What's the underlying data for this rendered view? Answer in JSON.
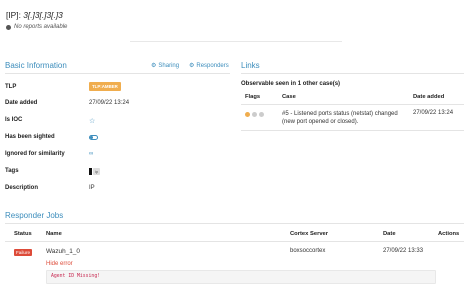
{
  "header": {
    "prefix": "[IP]:",
    "value": "3[.]3[.]3[.]3",
    "no_reports": "No reports available"
  },
  "basic": {
    "title": "Basic Information",
    "sharing_label": "Sharing",
    "responders_label": "Responders",
    "rows": {
      "tlp_label": "TLP",
      "tlp_value": "TLP:AMBER",
      "date_label": "Date added",
      "date_value": "27/09/22 13:24",
      "ioc_label": "Is IOC",
      "sighted_label": "Has been sighted",
      "ignored_label": "Ignored for similarity",
      "tags_label": "Tags",
      "tags_chip": "ip",
      "desc_label": "Description",
      "desc_value": "IP"
    }
  },
  "links": {
    "title": "Links",
    "observable_text": "Observable seen in 1 other case(s)",
    "columns": {
      "flags": "Flags",
      "case": "Case",
      "date": "Date added"
    },
    "rows": [
      {
        "case": "#5 - Listened ports status (netstat) changed (new port opened or closed).",
        "date": "27/09/22 13:24",
        "flag_colors": [
          "#f0ad4e",
          "#cccccc",
          "#cccccc"
        ]
      }
    ]
  },
  "responder_jobs": {
    "title": "Responder Jobs",
    "columns": {
      "status": "Status",
      "name": "Name",
      "server": "Cortex Server",
      "date": "Date",
      "actions": "Actions"
    },
    "rows": [
      {
        "status": "Failure",
        "name": "Wazuh_1_0",
        "server": "boxsoccortex",
        "date": "27/09/22 13:33",
        "hide_error": "Hide error",
        "error": "Agent ID Missing!"
      }
    ]
  },
  "colors": {
    "accent": "#3c8dbc",
    "tlp_amber": "#f0ad4e",
    "failure": "#dd4b39"
  }
}
